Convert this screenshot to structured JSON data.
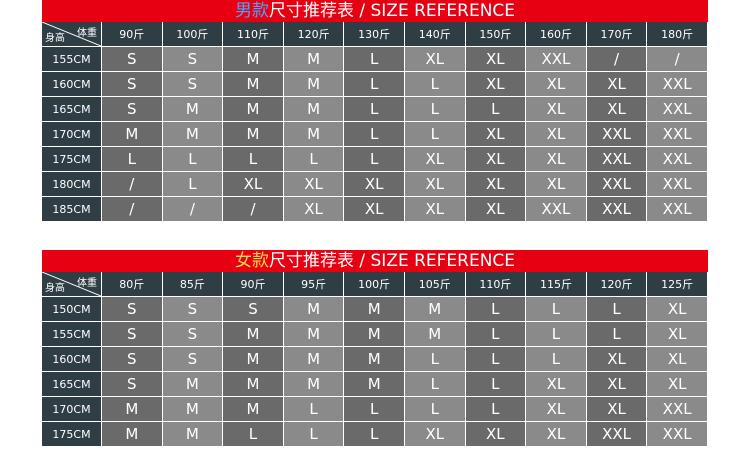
{
  "men": {
    "title_accent": "男款",
    "title_rest": "尺寸推荐表 / SIZE REFERENCE",
    "corner_weight": "体重",
    "corner_height": "身高",
    "columns": [
      "90斤",
      "100斤",
      "110斤",
      "120斤",
      "130斤",
      "140斤",
      "150斤",
      "160斤",
      "170斤",
      "180斤"
    ],
    "rows": [
      {
        "height": "155CM",
        "sizes": [
          "S",
          "S",
          "M",
          "M",
          "L",
          "XL",
          "XL",
          "XXL",
          "/",
          "/"
        ]
      },
      {
        "height": "160CM",
        "sizes": [
          "S",
          "S",
          "M",
          "M",
          "L",
          "L",
          "XL",
          "XL",
          "XL",
          "XXL"
        ]
      },
      {
        "height": "165CM",
        "sizes": [
          "S",
          "M",
          "M",
          "M",
          "L",
          "L",
          "L",
          "XL",
          "XL",
          "XXL"
        ]
      },
      {
        "height": "170CM",
        "sizes": [
          "M",
          "M",
          "M",
          "M",
          "L",
          "L",
          "XL",
          "XL",
          "XXL",
          "XXL"
        ]
      },
      {
        "height": "175CM",
        "sizes": [
          "L",
          "L",
          "L",
          "L",
          "L",
          "XL",
          "XL",
          "XL",
          "XXL",
          "XXL"
        ]
      },
      {
        "height": "180CM",
        "sizes": [
          "/",
          "L",
          "XL",
          "XL",
          "XL",
          "XL",
          "XL",
          "XL",
          "XXL",
          "XXL"
        ]
      },
      {
        "height": "185CM",
        "sizes": [
          "/",
          "/",
          "/",
          "XL",
          "XL",
          "XL",
          "XL",
          "XXL",
          "XXL",
          "XXL"
        ]
      }
    ]
  },
  "women": {
    "title_accent": "女款",
    "title_rest": "尺寸推荐表 / SIZE REFERENCE",
    "corner_weight": "体重",
    "corner_height": "身高",
    "columns": [
      "80斤",
      "85斤",
      "90斤",
      "95斤",
      "100斤",
      "105斤",
      "110斤",
      "115斤",
      "120斤",
      "125斤"
    ],
    "rows": [
      {
        "height": "150CM",
        "sizes": [
          "S",
          "S",
          "S",
          "M",
          "M",
          "M",
          "L",
          "L",
          "L",
          "XL"
        ]
      },
      {
        "height": "155CM",
        "sizes": [
          "S",
          "S",
          "M",
          "M",
          "M",
          "M",
          "L",
          "L",
          "L",
          "XL"
        ]
      },
      {
        "height": "160CM",
        "sizes": [
          "S",
          "S",
          "M",
          "M",
          "M",
          "L",
          "L",
          "L",
          "XL",
          "XL"
        ]
      },
      {
        "height": "165CM",
        "sizes": [
          "S",
          "M",
          "M",
          "M",
          "M",
          "L",
          "L",
          "XL",
          "XL",
          "XL"
        ]
      },
      {
        "height": "170CM",
        "sizes": [
          "M",
          "M",
          "M",
          "L",
          "L",
          "L",
          "L",
          "XL",
          "XL",
          "XXL"
        ]
      },
      {
        "height": "175CM",
        "sizes": [
          "M",
          "M",
          "L",
          "L",
          "L",
          "XL",
          "XL",
          "XL",
          "XXL",
          "XXL"
        ]
      }
    ]
  },
  "colors": {
    "title_red": "#e60012",
    "header_dark": "#2f3d45",
    "cell_dark": "#6a6a6a",
    "cell_light": "#8a8a8a"
  }
}
